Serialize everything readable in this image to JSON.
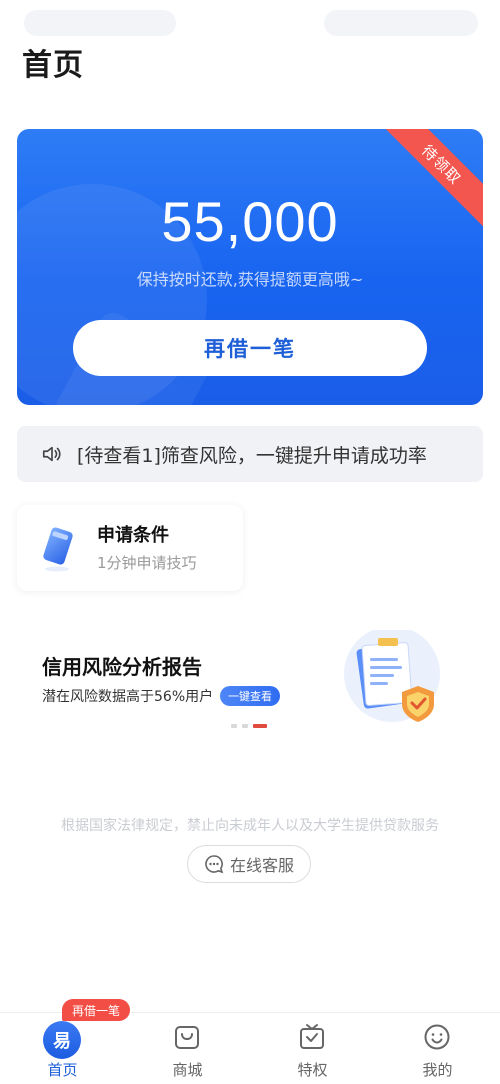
{
  "page": {
    "title": "首页"
  },
  "hero": {
    "ribbon": "待领取",
    "amount": "55,000",
    "subtitle": "保持按时还款,获得提额更高哦~",
    "button": "再借一笔"
  },
  "notice": {
    "text": "[待查看1]筛查风险，一键提升申请成功率",
    "icon": "speaker-icon"
  },
  "conditions": {
    "title": "申请条件",
    "subtitle": "1分钟申请技巧",
    "icon": "card-icon"
  },
  "banner": {
    "title": "信用风险分析报告",
    "subtitle": "潜在风险数据高于56%用户",
    "button": "一键查看",
    "image": "report-shield-illustration",
    "pages": 3,
    "active_page": 3
  },
  "legal": {
    "text": "根据国家法律规定，禁止向未成年人以及大学生提供贷款服务"
  },
  "service": {
    "label": "在线客服",
    "icon": "chat-icon"
  },
  "tabbar": {
    "badge": "再借一笔",
    "home_glyph": "易",
    "items": [
      {
        "label": "首页",
        "icon": "home-icon"
      },
      {
        "label": "商城",
        "icon": "shop-bag-icon"
      },
      {
        "label": "特权",
        "icon": "privilege-icon"
      },
      {
        "label": "我的",
        "icon": "profile-icon"
      }
    ]
  },
  "colors": {
    "primary": "#1d5fd8",
    "ribbon": "#f2564f",
    "badge": "#f24e46"
  }
}
